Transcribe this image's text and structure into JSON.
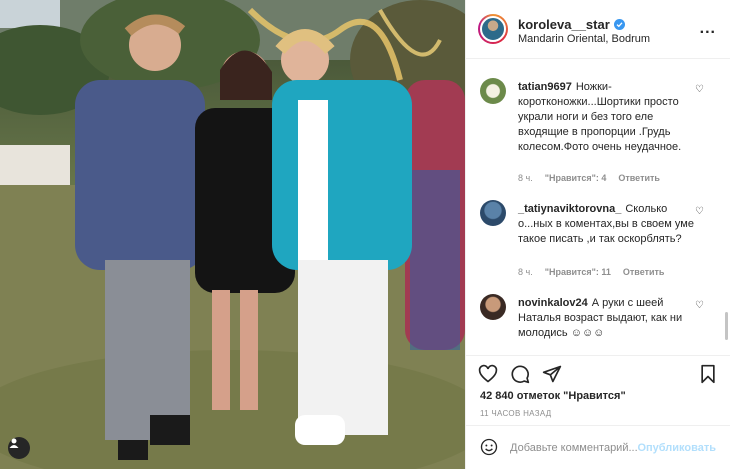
{
  "post": {
    "username": "koroleva__star",
    "location": "Mandarin Oriental, Bodrum",
    "more_label": "..."
  },
  "comments": [
    {
      "user": "tatian9697",
      "text": "Ножки-коротконожки...Шортики просто украли ноги и без того еле входящие в пропорции .Грудь колесом.Фото очень неудачное.",
      "time": "8 ч.",
      "likes": "\"Нравится\": 4",
      "reply": "Ответить"
    },
    {
      "user": "_tatiynaviktorovna_",
      "text": "Сколько о...ных в коментах,вы в своем уме такое писать ,и так оскорблять?",
      "time": "8 ч.",
      "likes": "\"Нравится\": 11",
      "reply": "Ответить"
    },
    {
      "user": "novinkalov24",
      "text": "А руки с шеей Наталья возраст выдают, как ни молодись ☺☺☺",
      "time": "",
      "likes": "",
      "reply": ""
    }
  ],
  "likes_text": "42 840 отметок \"Нравится\"",
  "timestamp": "11 ЧАСОВ НАЗАД",
  "comment_placeholder": "Добавьте комментарий...",
  "publish_label": "Опубликовать",
  "colors": {
    "link": "#3897f0",
    "publish_disabled": "#b2dffc",
    "muted": "#8e8e8e"
  }
}
